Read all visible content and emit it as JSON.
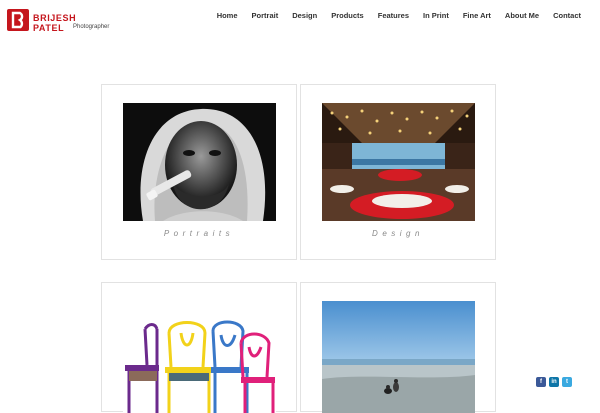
{
  "brand": {
    "name": "BRIJESH PATEL",
    "tagline": "Photographer",
    "accent_color": "#c5161d"
  },
  "nav": {
    "items": [
      {
        "label": "Home"
      },
      {
        "label": "Portrait"
      },
      {
        "label": "Design"
      },
      {
        "label": "Products"
      },
      {
        "label": "Features"
      },
      {
        "label": "In Print"
      },
      {
        "label": "Fine Art"
      },
      {
        "label": "About Me"
      },
      {
        "label": "Contact"
      }
    ]
  },
  "gallery": {
    "cards": [
      {
        "caption": "Portraits",
        "image": "portrait-photo"
      },
      {
        "caption": "Design",
        "image": "restaurant-interior-photo"
      },
      {
        "caption": "",
        "image": "colorful-chairs-photo"
      },
      {
        "caption": "",
        "image": "beach-couple-photo"
      }
    ]
  },
  "social": {
    "items": [
      {
        "icon": "facebook-icon",
        "glyph": "f",
        "color": "#3b5998"
      },
      {
        "icon": "linkedin-icon",
        "glyph": "in",
        "color": "#0e76a8"
      },
      {
        "icon": "twitter-icon",
        "glyph": "t",
        "color": "#3aa9e0"
      }
    ]
  }
}
